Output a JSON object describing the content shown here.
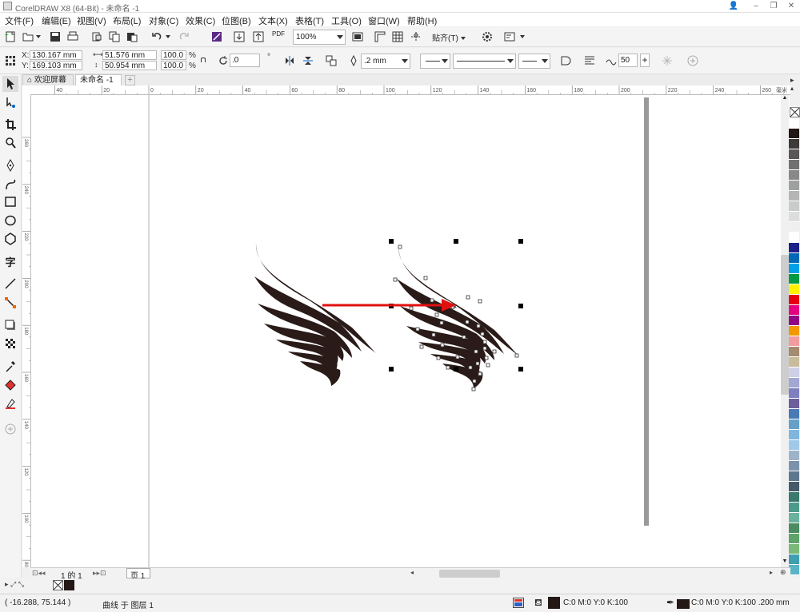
{
  "window": {
    "title": "CorelDRAW X8 (64-Bit) - 未命名 -1"
  },
  "menu": [
    "文件(F)",
    "编辑(E)",
    "视图(V)",
    "布局(L)",
    "对象(C)",
    "效果(C)",
    "位图(B)",
    "文本(X)",
    "表格(T)",
    "工具(O)",
    "窗口(W)",
    "帮助(H)"
  ],
  "standard_toolbar": {
    "zoom": "100%",
    "snap_label": "贴齐(T)",
    "pdf_label": "PDF"
  },
  "property_bar": {
    "x": "130.167 mm",
    "y": "169.103 mm",
    "width": "51.576 mm",
    "height": "50.954 mm",
    "scale_x": "100.0",
    "scale_y": "100.0",
    "percent": "%",
    "rotation": ".0",
    "outline_width": ".2 mm",
    "smooth": "50"
  },
  "doc_tabs": {
    "welcome": "欢迎屏幕",
    "document": "未命名 -1"
  },
  "rulers": {
    "h_ticks": [
      "40",
      "20",
      "0",
      "20",
      "40",
      "60",
      "80",
      "100",
      "120",
      "140",
      "160",
      "180",
      "200",
      "220",
      "240",
      "260"
    ],
    "h_unit": "毫米",
    "v_ticks": [
      "260",
      "240",
      "220",
      "200",
      "180",
      "160",
      "140",
      "120",
      "100",
      "80"
    ]
  },
  "page_nav": {
    "page_of": "1 的 1",
    "page_tab": "页 1"
  },
  "status": {
    "coords": "( -16.288, 75.144 )",
    "object_info": "曲线 于 图层 1",
    "fill_info": "C:0 M:0 Y:0 K:100",
    "outline_info": "C:0 M:0 Y:0 K:100  .200 mm"
  },
  "colors": {
    "wing": "#2a1b18",
    "arrow": "#e01010",
    "selection": "#000000"
  },
  "palette": [
    "#ffffff",
    "#231815",
    "#3e3a39",
    "#595757",
    "#727171",
    "#898989",
    "#9fa0a0",
    "#b5b5b6",
    "#c9caca",
    "#dcdddd",
    "#efefef",
    "#ffffff",
    "#1d2088",
    "#0068b7",
    "#00a0e9",
    "#009944",
    "#fff100",
    "#e60012",
    "#e4007f",
    "#920783",
    "#f39800",
    "#f29c9f",
    "#a58b6f",
    "#c9bc9c",
    "#cfd0e8",
    "#a3a7d4",
    "#7f7fbf",
    "#6e5f9c",
    "#4a7ab5",
    "#64a0c8",
    "#7eb6de",
    "#a0c8e8",
    "#9fb3c8",
    "#7a92ab",
    "#5e7790",
    "#45596b",
    "#3a7a6e",
    "#4e9a8a",
    "#6bb29e",
    "#4c8c62",
    "#5ea36a",
    "#7bb97a",
    "#3f9fb0",
    "#5ab4c6"
  ]
}
